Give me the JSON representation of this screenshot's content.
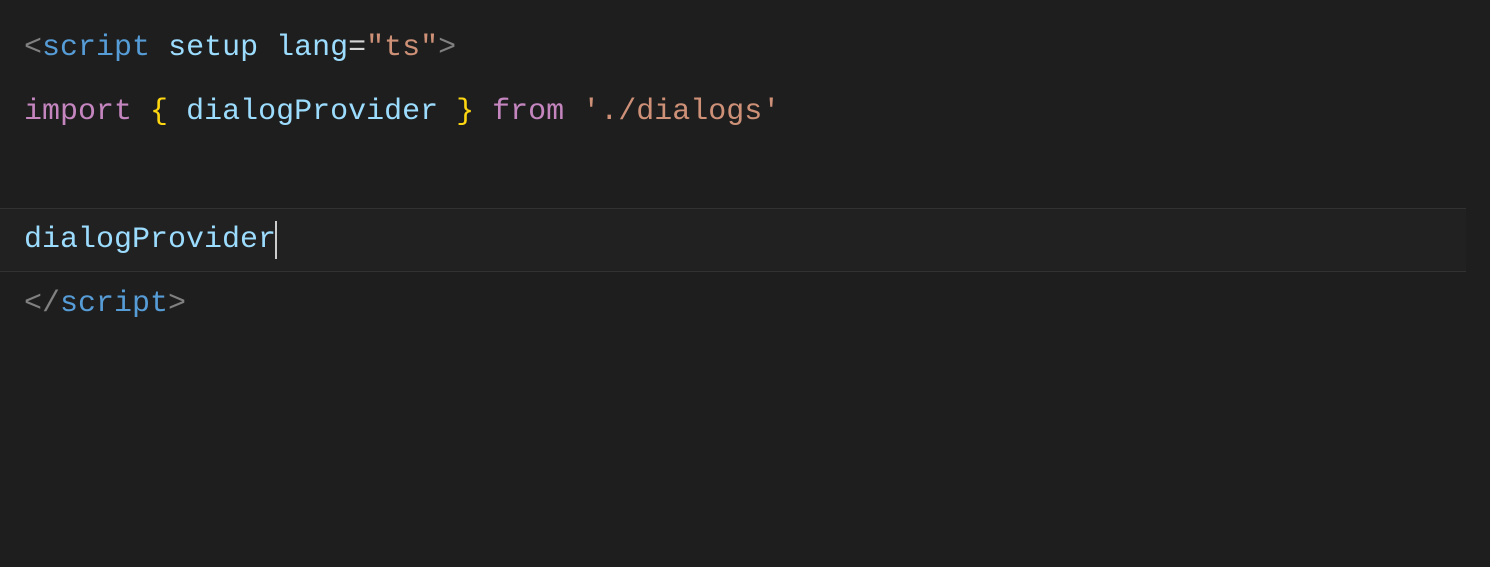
{
  "code": {
    "line1": {
      "lt": "<",
      "tag": "script",
      "sp1": " ",
      "attr1": "setup",
      "sp2": " ",
      "attr2": "lang",
      "eq": "=",
      "q1": "\"",
      "val": "ts",
      "q2": "\"",
      "gt": ">"
    },
    "line2": {
      "kw1": "import",
      "sp1": " ",
      "lb": "{",
      "sp2": " ",
      "ident": "dialogProvider",
      "sp3": " ",
      "rb": "}",
      "sp4": " ",
      "kw2": "from",
      "sp5": " ",
      "q1": "'",
      "path": "./dialogs",
      "q2": "'"
    },
    "line4": {
      "ident": "dialogProvider"
    },
    "line5": {
      "lt": "</",
      "tag": "script",
      "gt": ">"
    }
  }
}
